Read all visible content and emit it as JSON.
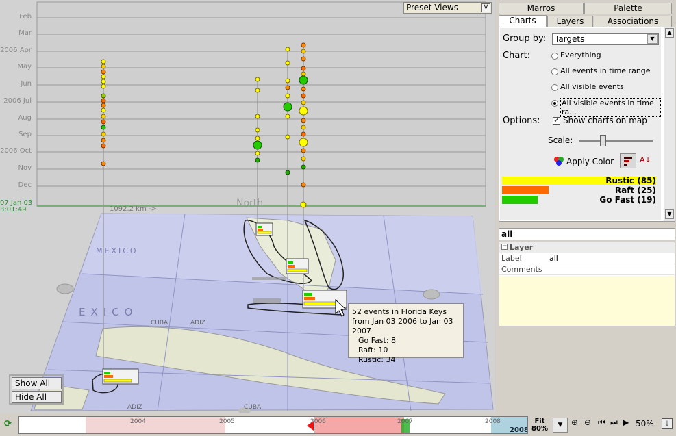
{
  "view3d": {
    "preset_views_label": "Preset Views",
    "preset_views_button": "V",
    "months": [
      "Feb",
      "Mar",
      "2006 Apr",
      "May",
      "Jun",
      "2006 Jul",
      "Aug",
      "Sep",
      "2006 Oct",
      "Nov",
      "Dec"
    ],
    "date_label_line1": "07 Jan 03",
    "date_label_line2": "3:01:49",
    "distance_label": "1092.2 km ->",
    "north_label": "North",
    "tooltip": {
      "line1": "52 events in Florida Keys",
      "line2": "from Jan 03 2006 to Jan 03 2007",
      "line3": "Go Fast: 8",
      "line4": "Raft: 10",
      "line5": "Rustic: 34"
    },
    "show_all_button": "Show All",
    "hide_all_button": "Hide All",
    "map_labels": [
      "MEXICO",
      "EXICO",
      "CUBA",
      "ADIZ",
      "CUBA",
      "ADIZ"
    ]
  },
  "right_panel": {
    "tabs_row1": [
      "Marros",
      "Palette"
    ],
    "tabs_row2": [
      "Charts",
      "Layers",
      "Associations"
    ],
    "active_tab": "Charts",
    "group_by_label": "Group by:",
    "group_by_value": "Targets",
    "chart_label": "Chart:",
    "chart_options": [
      "Everything",
      "All events in time range",
      "All visible events",
      "All visible events in time ra..."
    ],
    "selected_chart_option": 3,
    "options_label": "Options:",
    "show_charts_label": "Show charts on map",
    "show_charts_checked": true,
    "scale_label": "Scale:",
    "apply_color_label": "Apply Color",
    "bars": [
      {
        "label": "Rustic (85)",
        "value": 85,
        "color": "#ffff00"
      },
      {
        "label": "Raft (25)",
        "value": 25,
        "color": "#ff6a00"
      },
      {
        "label": "Go Fast (19)",
        "value": 19,
        "color": "#22cc00"
      }
    ],
    "selection_title": "all",
    "layer_section": "Layer",
    "props": [
      {
        "key": "Label",
        "value": "all"
      },
      {
        "key": "Comments",
        "value": ""
      }
    ]
  },
  "timeline": {
    "years": [
      "2004",
      "2005",
      "2006",
      "2007",
      "2008"
    ],
    "current_year": "2008",
    "fit_label": "Fit",
    "fit_percent": "80%",
    "zoom_percent": "50%"
  },
  "colors": {
    "rustic": "#ffff00",
    "raft": "#ff6a00",
    "go_fast": "#22cc00",
    "map_bg": "#b8bfe6"
  }
}
